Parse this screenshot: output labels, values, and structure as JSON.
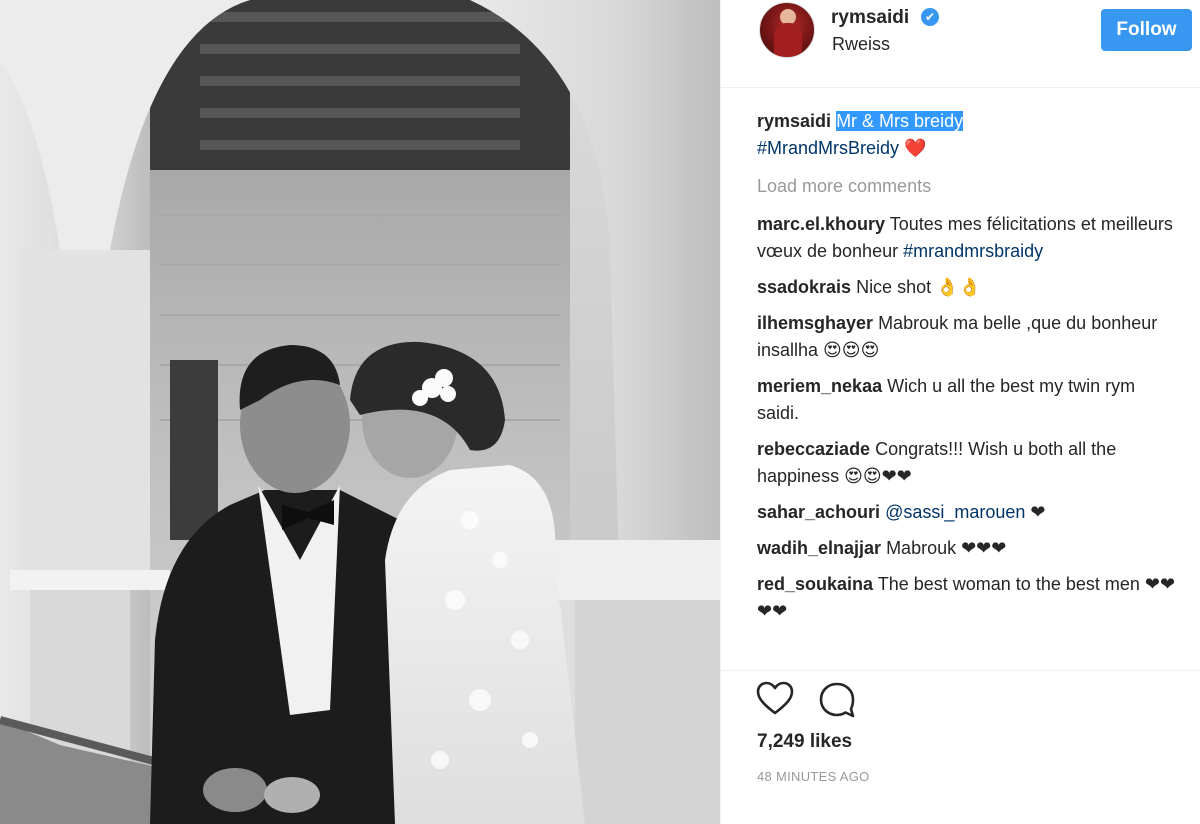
{
  "header": {
    "username": "rymsaidi",
    "verified_mark": "✔",
    "location": "Rweiss",
    "follow_label": "Follow"
  },
  "caption": {
    "username": "rymsaidi",
    "text_highlighted": "Mr & Mrs breidy",
    "hashtag": "#MrandMrsBreidy",
    "suffix": " ❤️"
  },
  "load_more_label": "Load more comments",
  "comments": [
    {
      "username": "marc.el.khoury",
      "text": " Toutes mes félicitations et meilleurs vœux de bonheur ",
      "tag": "#mrandmrsbraidy"
    },
    {
      "username": "ssadokrais",
      "text": " Nice shot 👌👌"
    },
    {
      "username": "ilhemsghayer",
      "text": " Mabrouk ma belle ,que du bonheur insallha 😍😍😍"
    },
    {
      "username": "meriem_nekaa",
      "text": " Wich u all the best my twin rym saidi."
    },
    {
      "username": "rebeccaziade",
      "text": " Congrats!!! Wish u both all the happiness 😍😍❤❤"
    },
    {
      "username": "sahar_achouri",
      "text_before": " ",
      "mention": "@sassi_marouen",
      "text": " ❤"
    },
    {
      "username": "wadih_elnajjar",
      "text": " Mabrouk ❤❤❤"
    },
    {
      "username": "red_soukaina",
      "text": " The best woman to the best men ❤❤❤❤"
    }
  ],
  "actions": {
    "like_icon": "heart-icon",
    "comment_icon": "comment-icon",
    "likes": "7,249 likes",
    "timestamp": "48 MINUTES AGO"
  },
  "colors": {
    "accent": "#3897f0",
    "hashtag": "#003569",
    "muted": "#999999",
    "highlight": "#3399ff"
  }
}
